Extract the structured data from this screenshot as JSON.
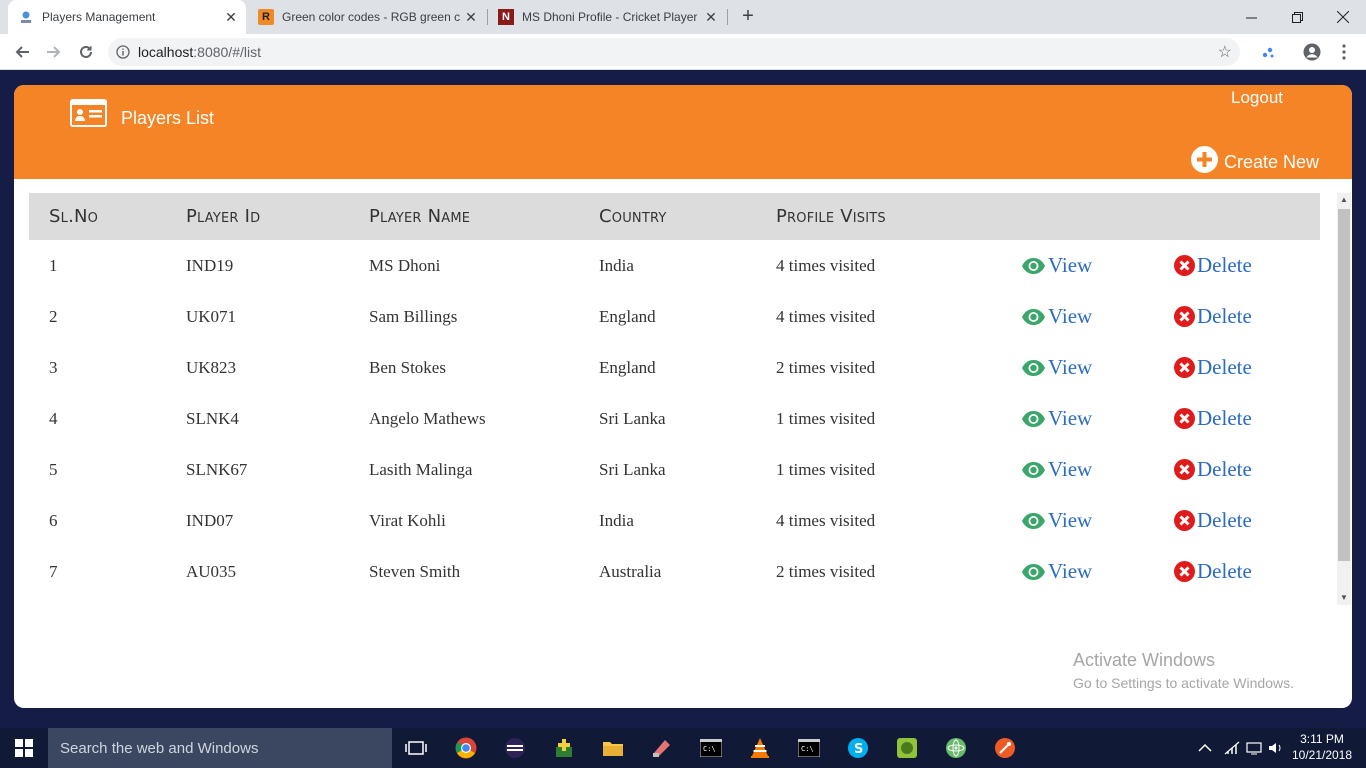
{
  "browser": {
    "tabs": [
      {
        "title": "Players Management",
        "active": true
      },
      {
        "title": "Green color codes - RGB green c",
        "active": false
      },
      {
        "title": "MS Dhoni Profile - Cricket Player",
        "active": false
      }
    ],
    "url_host": "localhost",
    "url_rest": ":8080/#/list"
  },
  "header": {
    "title": "Players List",
    "logout_label": "Logout",
    "create_label": "Create New"
  },
  "table": {
    "columns": [
      "Sl.No",
      "Player Id",
      "Player Name",
      "Country",
      "Profile Visits"
    ],
    "view_label": "View",
    "delete_label": "Delete",
    "rows": [
      {
        "sl": "1",
        "id": "IND19",
        "name": "MS Dhoni",
        "country": "India",
        "visits": "4 times visited"
      },
      {
        "sl": "2",
        "id": "UK071",
        "name": "Sam Billings",
        "country": "England",
        "visits": "4 times visited"
      },
      {
        "sl": "3",
        "id": "UK823",
        "name": "Ben Stokes",
        "country": "England",
        "visits": "2 times visited"
      },
      {
        "sl": "4",
        "id": "SLNK4",
        "name": "Angelo Mathews",
        "country": "Sri Lanka",
        "visits": "1 times visited"
      },
      {
        "sl": "5",
        "id": "SLNK67",
        "name": "Lasith Malinga",
        "country": "Sri Lanka",
        "visits": "1 times visited"
      },
      {
        "sl": "6",
        "id": "IND07",
        "name": "Virat Kohli",
        "country": "India",
        "visits": "4 times visited"
      },
      {
        "sl": "7",
        "id": "AU035",
        "name": "Steven Smith",
        "country": "Australia",
        "visits": "2 times visited"
      }
    ]
  },
  "watermark": {
    "line1": "Activate Windows",
    "line2": "Go to Settings to activate Windows."
  },
  "taskbar": {
    "search_placeholder": "Search the web and Windows",
    "time": "3:11 PM",
    "date": "10/21/2018"
  },
  "colors": {
    "header_orange": "#f58426",
    "view_green": "#3aa66b",
    "delete_red": "#e01b1b",
    "link_blue": "#2a6bc4"
  }
}
